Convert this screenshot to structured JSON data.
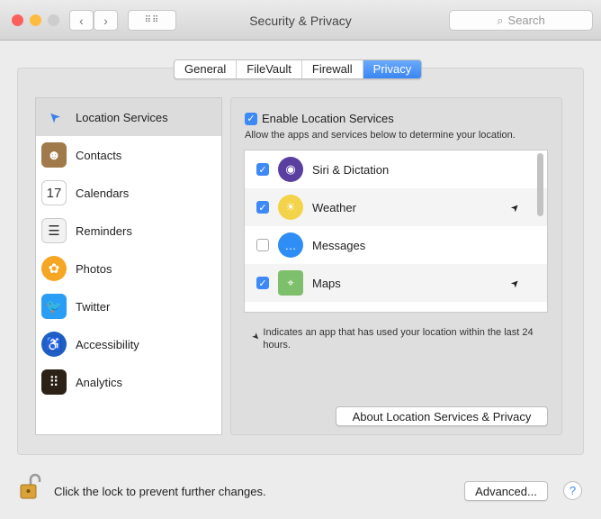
{
  "window": {
    "title": "Security & Privacy",
    "search_placeholder": "Search"
  },
  "tabs": [
    {
      "label": "General"
    },
    {
      "label": "FileVault"
    },
    {
      "label": "Firewall"
    },
    {
      "label": "Privacy",
      "selected": true
    }
  ],
  "sidebar": {
    "items": [
      {
        "label": "Location Services",
        "icon": "location-arrow-icon",
        "color": "#3b7fe8",
        "selected": true
      },
      {
        "label": "Contacts",
        "icon": "contacts-book-icon",
        "color": "#a07a4a"
      },
      {
        "label": "Calendars",
        "icon": "calendar-icon",
        "color": "#ffffff"
      },
      {
        "label": "Reminders",
        "icon": "reminders-list-icon",
        "color": "#f2f2f2"
      },
      {
        "label": "Photos",
        "icon": "photos-flower-icon",
        "color": "#f5a623"
      },
      {
        "label": "Twitter",
        "icon": "twitter-bird-icon",
        "color": "#2a9df4"
      },
      {
        "label": "Accessibility",
        "icon": "accessibility-person-icon",
        "color": "#1f5fc4"
      },
      {
        "label": "Analytics",
        "icon": "analytics-grid-icon",
        "color": "#2b2116"
      }
    ]
  },
  "location": {
    "enable_label": "Enable Location Services",
    "enabled": true,
    "description": "Allow the apps and services below to determine your location.",
    "apps": [
      {
        "name": "Siri & Dictation",
        "checked": true,
        "recent": false,
        "icon": "siri-icon",
        "color": "#5a3fa0"
      },
      {
        "name": "Weather",
        "checked": true,
        "recent": true,
        "icon": "weather-sun-cloud-icon",
        "color": "#f3d34a"
      },
      {
        "name": "Messages",
        "checked": false,
        "recent": false,
        "icon": "messages-bubble-icon",
        "color": "#2f8ef5"
      },
      {
        "name": "Maps",
        "checked": true,
        "recent": true,
        "icon": "maps-icon",
        "color": "#7dbf6a"
      }
    ],
    "legend": "Indicates an app that has used your location within the last 24 hours.",
    "about_button": "About Location Services & Privacy"
  },
  "footer": {
    "lock_text": "Click the lock to prevent further changes.",
    "advanced_button": "Advanced...",
    "help": "?"
  }
}
